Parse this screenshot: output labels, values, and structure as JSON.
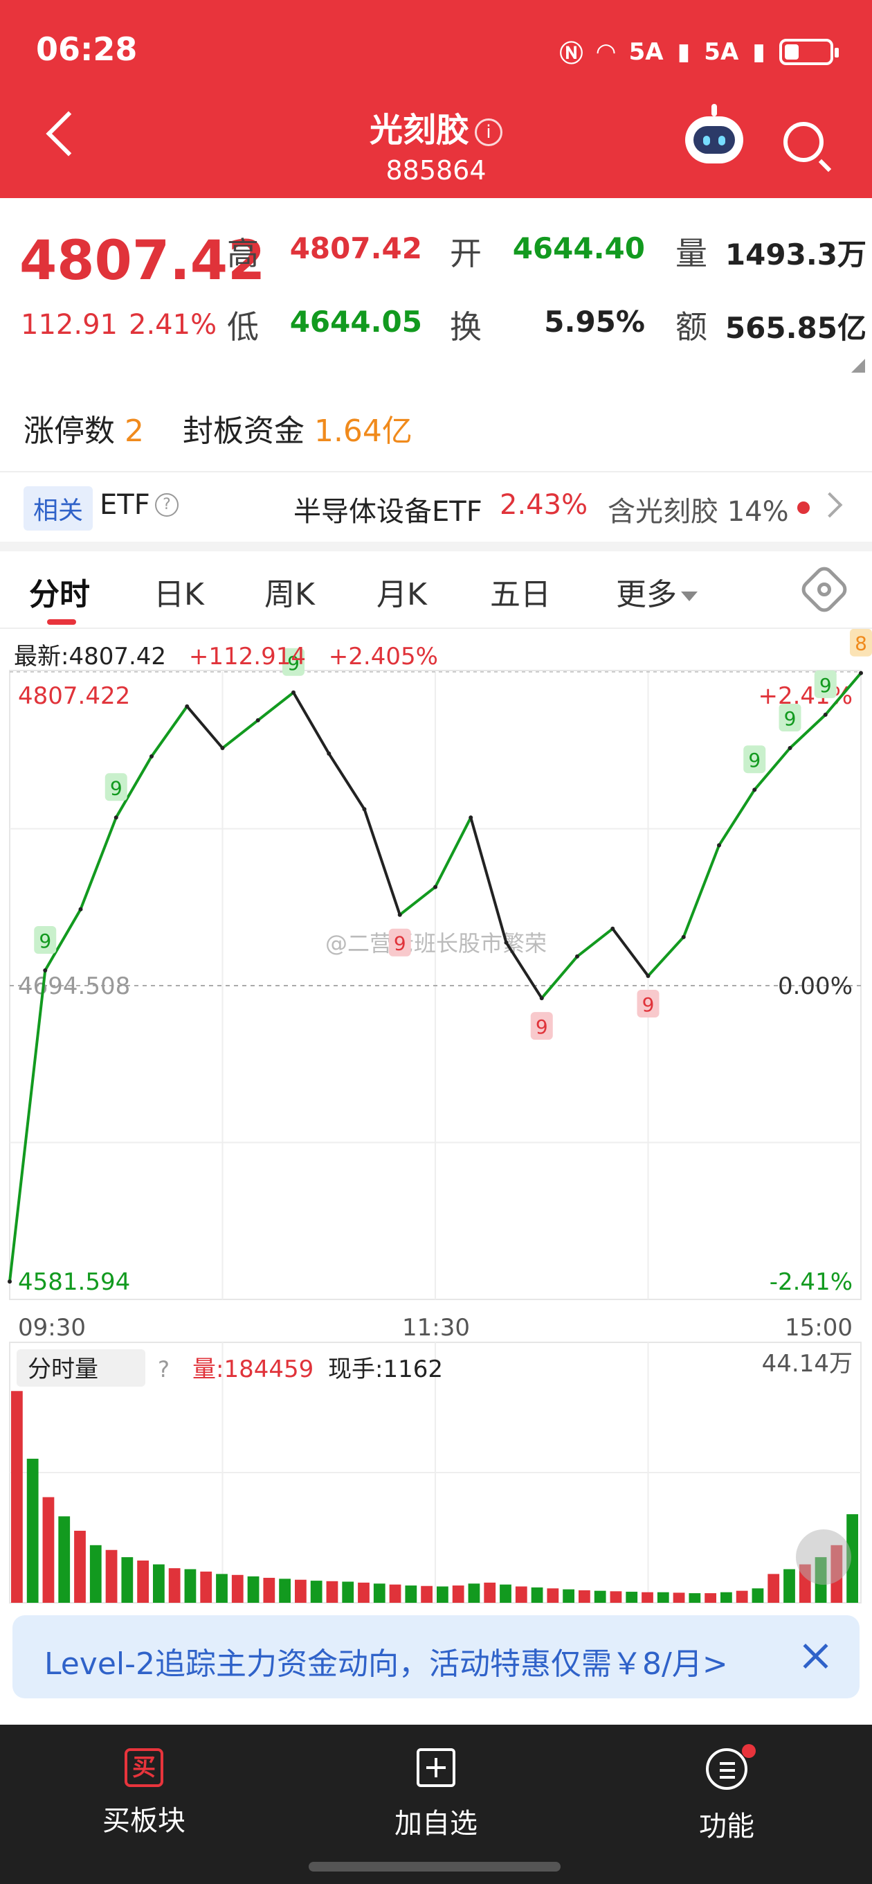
{
  "status": {
    "time": "06:28",
    "net1": "5A",
    "net2": "5A"
  },
  "header": {
    "title": "光刻胶",
    "code": "885864"
  },
  "quote": {
    "price": "4807.42",
    "change": "112.91",
    "change_pct": "2.41%",
    "labels": {
      "high": "高",
      "low": "低",
      "open": "开",
      "turnover": "换",
      "volume": "量",
      "amount": "额"
    },
    "high": "4807.42",
    "low": "4644.05",
    "open": "4644.40",
    "turnover": "5.95%",
    "volume": "1493.3万",
    "amount": "565.85亿",
    "limit_up_label": "涨停数",
    "limit_up_count": "2",
    "seal_label": "封板资金",
    "seal_amount": "1.64亿"
  },
  "etf": {
    "tag": "相关",
    "word": "ETF",
    "name": "半导体设备ETF",
    "pct": "2.43%",
    "contains": "含光刻胶 14%"
  },
  "tabs": [
    "分时",
    "日K",
    "周K",
    "月K",
    "五日",
    "更多"
  ],
  "chart_top": {
    "latest_label": "最新:4807.42",
    "latest_chg": "+112.914",
    "latest_pct": "+2.405%",
    "ymax_label": "4807.422",
    "ymid_label": "4694.508",
    "ymin_label": "4581.594",
    "pct_top": "+2.41%",
    "pct_mid": "0.00%",
    "pct_bot": "-2.41%",
    "x_ticks": [
      "09:30",
      "11:30",
      "15:00"
    ],
    "watermark": "@二营老班长股市繁荣"
  },
  "volume_panel": {
    "selector": "分时量",
    "vol_label": "量:184459",
    "now_label": "现手:1162",
    "max_label": "44.14万"
  },
  "chart_data": {
    "type": "line",
    "title": "",
    "xlabel": "",
    "ylabel": "",
    "ylim": [
      4581.594,
      4807.422
    ],
    "prev_close": 4694.508,
    "x": [
      "09:30",
      "09:40",
      "09:50",
      "10:00",
      "10:10",
      "10:20",
      "10:30",
      "10:40",
      "10:50",
      "11:00",
      "11:10",
      "11:20",
      "11:30",
      "13:10",
      "13:20",
      "13:30",
      "13:40",
      "13:50",
      "14:00",
      "14:10",
      "14:20",
      "14:30",
      "14:40",
      "14:50",
      "15:00"
    ],
    "series": [
      {
        "values": [
          4588,
          4700,
          4722,
          4755,
          4777,
          4795,
          4780,
          4790,
          4800,
          4778,
          4758,
          4720,
          4730,
          4755,
          4710,
          4690,
          4705,
          4715,
          4698,
          4712,
          4745,
          4765,
          4780,
          4792,
          4807
        ]
      }
    ],
    "signal_markers": [
      {
        "time": "09:40",
        "label": "9"
      },
      {
        "time": "10:00",
        "label": "9"
      },
      {
        "time": "10:50",
        "label": "9"
      },
      {
        "time": "11:20",
        "label": "9"
      },
      {
        "time": "13:30",
        "label": "9"
      },
      {
        "time": "14:00",
        "label": "9"
      },
      {
        "time": "14:30",
        "label": "9"
      },
      {
        "time": "14:40",
        "label": "9"
      },
      {
        "time": "14:50",
        "label": "9"
      },
      {
        "time": "15:00",
        "label": "8"
      }
    ],
    "volume": {
      "ymax": 441400,
      "values": [
        441000,
        300000,
        220000,
        180000,
        150000,
        120000,
        110000,
        95000,
        88000,
        80000,
        72000,
        70000,
        65000,
        60000,
        58000,
        55000,
        52000,
        50000,
        48000,
        46000,
        45000,
        44000,
        42000,
        40000,
        38000,
        36000,
        35000,
        34000,
        36000,
        40000,
        42000,
        38000,
        34000,
        32000,
        30000,
        28000,
        26000,
        25000,
        24000,
        23000,
        22000,
        22000,
        21000,
        20000,
        20000,
        22000,
        25000,
        30000,
        60000,
        70000,
        80000,
        95000,
        120000,
        184459
      ]
    }
  },
  "banner": {
    "text": "Level-2追踪主力资金动向，活动特惠仅需￥8/月>"
  },
  "bottom_nav": {
    "buy_icon": "买",
    "buy": "买板块",
    "add": "加自选",
    "func": "功能"
  }
}
